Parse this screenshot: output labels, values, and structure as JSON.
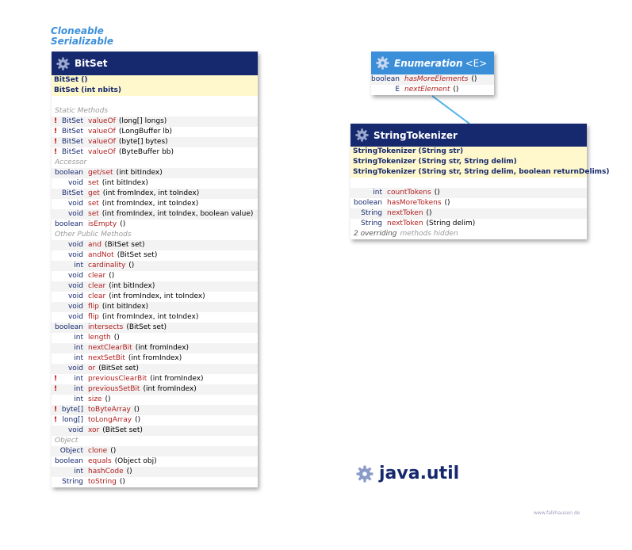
{
  "interfaces": [
    "Cloneable",
    "Serializable"
  ],
  "bitset": {
    "title": "BitSet",
    "constructors": [
      "BitSet ()",
      "BitSet (int nbits)"
    ],
    "sections": {
      "static": "Static Methods",
      "accessor": "Accessor",
      "other": "Other Public Methods",
      "object": "Object"
    },
    "static_methods": [
      {
        "type": "BitSet",
        "name": "valueOf",
        "params": "(long[] longs)"
      },
      {
        "type": "BitSet",
        "name": "valueOf",
        "params": "(LongBuffer lb)"
      },
      {
        "type": "BitSet",
        "name": "valueOf",
        "params": "(byte[] bytes)"
      },
      {
        "type": "BitSet",
        "name": "valueOf",
        "params": "(ByteBuffer bb)"
      }
    ],
    "accessor_methods": [
      {
        "type": "boolean",
        "name": "get/set",
        "params": "(int bitIndex)"
      },
      {
        "type": "void",
        "name": "set",
        "params": "(int bitIndex)"
      },
      {
        "type": "BitSet",
        "name": "get",
        "params": "(int fromIndex, int toIndex)"
      },
      {
        "type": "void",
        "name": "set",
        "params": "(int fromIndex, int toIndex)"
      },
      {
        "type": "void",
        "name": "set",
        "params": "(int fromIndex, int toIndex, boolean value)"
      },
      {
        "type": "boolean",
        "name": "isEmpty",
        "params": "()"
      }
    ],
    "other_methods": [
      {
        "type": "void",
        "name": "and",
        "params": "(BitSet set)"
      },
      {
        "type": "void",
        "name": "andNot",
        "params": "(BitSet set)"
      },
      {
        "type": "int",
        "name": "cardinality",
        "params": "()"
      },
      {
        "type": "void",
        "name": "clear",
        "params": "()"
      },
      {
        "type": "void",
        "name": "clear",
        "params": "(int bitIndex)"
      },
      {
        "type": "void",
        "name": "clear",
        "params": "(int fromIndex, int toIndex)"
      },
      {
        "type": "void",
        "name": "flip",
        "params": "(int bitIndex)"
      },
      {
        "type": "void",
        "name": "flip",
        "params": "(int fromIndex, int toIndex)"
      },
      {
        "type": "boolean",
        "name": "intersects",
        "params": "(BitSet set)"
      },
      {
        "type": "int",
        "name": "length",
        "params": "()"
      },
      {
        "type": "int",
        "name": "nextClearBit",
        "params": "(int fromIndex)"
      },
      {
        "type": "int",
        "name": "nextSetBit",
        "params": "(int fromIndex)"
      },
      {
        "type": "void",
        "name": "or",
        "params": "(BitSet set)"
      },
      {
        "type": "int",
        "name": "previousClearBit",
        "params": "(int fromIndex)"
      },
      {
        "type": "int",
        "name": "previousSetBit",
        "params": "(int fromIndex)"
      },
      {
        "type": "int",
        "name": "size",
        "params": "()"
      },
      {
        "type": "byte[]",
        "name": "toByteArray",
        "params": "()"
      },
      {
        "type": "long[]",
        "name": "toLongArray",
        "params": "()"
      },
      {
        "type": "void",
        "name": "xor",
        "params": "(BitSet set)"
      }
    ],
    "object_methods": [
      {
        "type": "Object",
        "name": "clone",
        "params": "()"
      },
      {
        "type": "boolean",
        "name": "equals",
        "params": "(Object obj)"
      },
      {
        "type": "int",
        "name": "hashCode",
        "params": "()"
      },
      {
        "type": "String",
        "name": "toString",
        "params": "()"
      }
    ]
  },
  "enumeration": {
    "title": "Enumeration",
    "generic": "<E>",
    "methods": [
      {
        "type": "boolean",
        "name": "hasMoreElements",
        "params": "()"
      },
      {
        "type": "E",
        "name": "nextElement",
        "params": "()"
      }
    ]
  },
  "tokenizer": {
    "title": "StringTokenizer",
    "constructors": [
      "StringTokenizer (String str)",
      "StringTokenizer (String str, String delim)",
      "StringTokenizer (String str, String delim, boolean returnDelims)"
    ],
    "methods": [
      {
        "type": "int",
        "name": "countTokens",
        "params": "()"
      },
      {
        "type": "boolean",
        "name": "hasMoreTokens",
        "params": "()"
      },
      {
        "type": "String",
        "name": "nextToken",
        "params": "()"
      },
      {
        "type": "String",
        "name": "nextToken",
        "params": "(String delim)"
      }
    ],
    "overriding_note": "2 overriding",
    "hidden_note": "methods hidden"
  },
  "package": "java.util",
  "footer": "www.falkhausen.de",
  "colors": {
    "header": "#16296e",
    "method": "#b21e1e",
    "interface": "#3b8fd9",
    "constructor_bg": "#fff8cc"
  }
}
